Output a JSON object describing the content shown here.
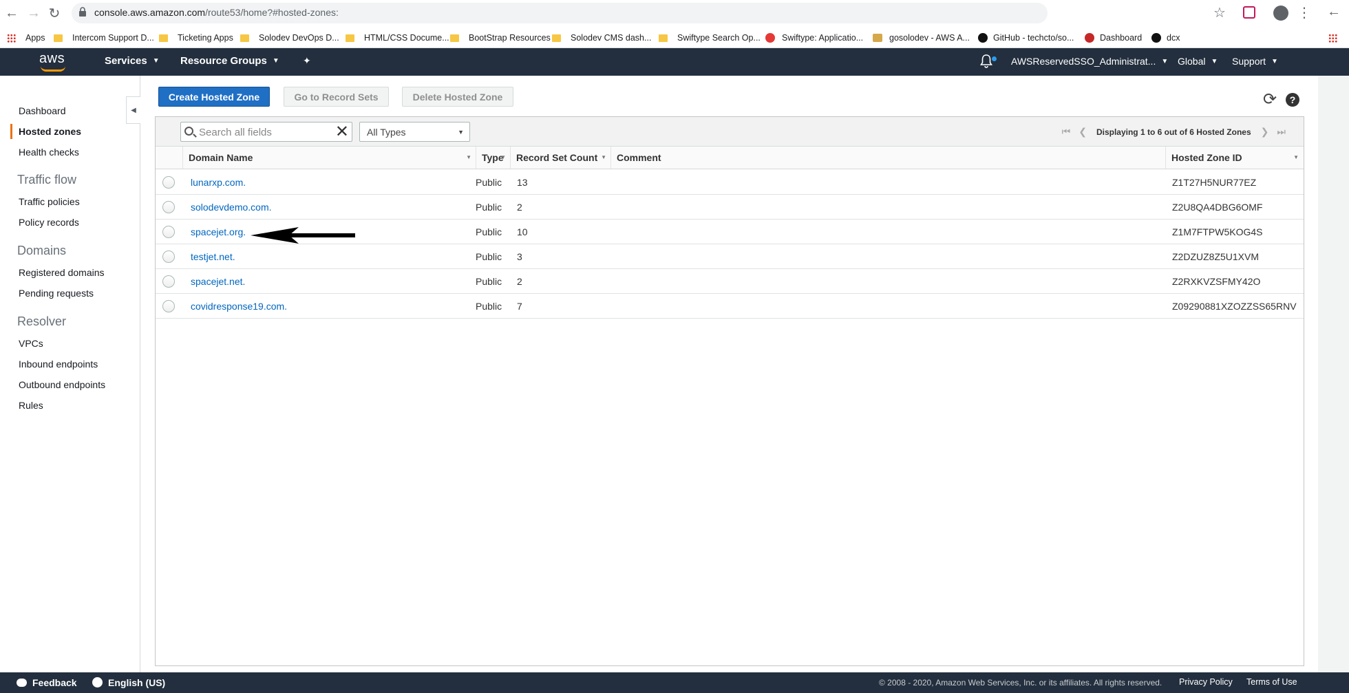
{
  "browser": {
    "url_host": "console.aws.amazon.com",
    "url_path": "/route53/home?#hosted-zones:",
    "bookmarks": [
      "Apps",
      "Intercom Support D...",
      "Ticketing Apps",
      "Solodev DevOps D...",
      "HTML/CSS Docume...",
      "BootStrap Resources",
      "Solodev CMS dash...",
      "Swiftype Search Op...",
      "Swiftype: Applicatio...",
      "gosolodev - AWS A...",
      "GitHub - techcto/so...",
      "Dashboard",
      "dcx"
    ]
  },
  "topnav": {
    "logo": "aws",
    "services": "Services",
    "resource_groups": "Resource Groups",
    "account": "AWSReservedSSO_Administrat...",
    "region": "Global",
    "support": "Support"
  },
  "sidebar": {
    "items": {
      "dashboard": "Dashboard",
      "hosted_zones": "Hosted zones",
      "health_checks": "Health checks",
      "traffic_flow": "Traffic flow",
      "traffic_policies": "Traffic policies",
      "policy_records": "Policy records",
      "domains": "Domains",
      "registered_domains": "Registered domains",
      "pending_requests": "Pending requests",
      "resolver": "Resolver",
      "vpcs": "VPCs",
      "inbound_endpoints": "Inbound endpoints",
      "outbound_endpoints": "Outbound endpoints",
      "rules": "Rules"
    },
    "active": "Hosted zones"
  },
  "toolbar": {
    "create": "Create Hosted Zone",
    "goto_records": "Go to Record Sets",
    "delete": "Delete Hosted Zone"
  },
  "filter": {
    "search_placeholder": "Search all fields",
    "type_select": "All Types",
    "pager_text": "Displaying 1 to 6 out of 6 Hosted Zones"
  },
  "table": {
    "columns": {
      "domain": "Domain Name",
      "type": "Type",
      "count": "Record Set Count",
      "comment": "Comment",
      "zone_id": "Hosted Zone ID"
    },
    "rows": [
      {
        "domain": "lunarxp.com.",
        "type": "Public",
        "count": "13",
        "comment": "",
        "zone_id": "Z1T27H5NUR77EZ"
      },
      {
        "domain": "solodevdemo.com.",
        "type": "Public",
        "count": "2",
        "comment": "",
        "zone_id": "Z2U8QA4DBG6OMF"
      },
      {
        "domain": "spacejet.org.",
        "type": "Public",
        "count": "10",
        "comment": "",
        "zone_id": "Z1M7FTPW5KOG4S"
      },
      {
        "domain": "testjet.net.",
        "type": "Public",
        "count": "3",
        "comment": "",
        "zone_id": "Z2DZUZ8Z5U1XVM"
      },
      {
        "domain": "spacejet.net.",
        "type": "Public",
        "count": "2",
        "comment": "",
        "zone_id": "Z2RXKVZSFMY42O"
      },
      {
        "domain": "covidresponse19.com.",
        "type": "Public",
        "count": "7",
        "comment": "",
        "zone_id": "Z09290881XZOZZSS65RNV"
      }
    ]
  },
  "footer": {
    "feedback": "Feedback",
    "language": "English (US)",
    "copyright": "© 2008 - 2020, Amazon Web Services, Inc. or its affiliates. All rights reserved.",
    "privacy": "Privacy Policy",
    "terms": "Terms of Use"
  },
  "colors": {
    "aws_nav": "#232f3e",
    "primary_button": "#1f6fc5",
    "active_accent": "#ec7211",
    "link": "#0066c0"
  }
}
